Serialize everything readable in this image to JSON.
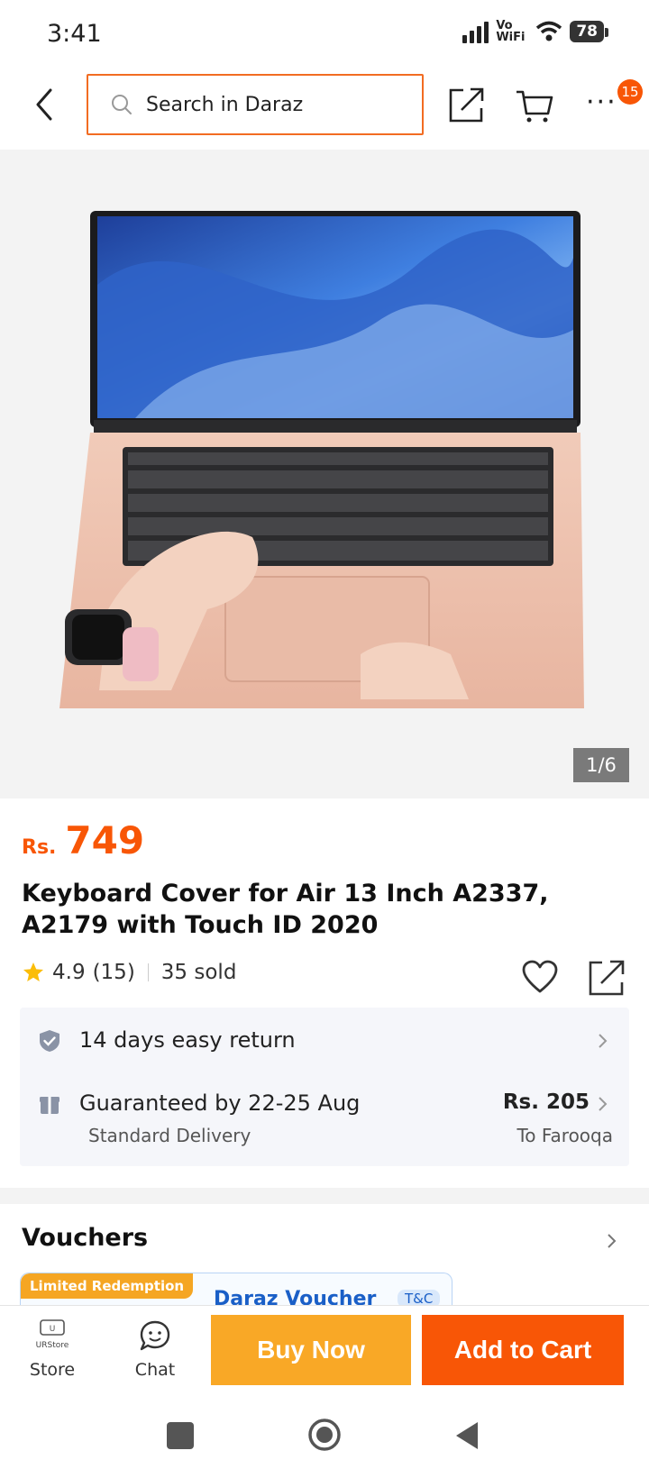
{
  "status_bar": {
    "time": "3:41",
    "network": "Vo WiFi",
    "battery": "78"
  },
  "header": {
    "search_placeholder": "Search in Daraz",
    "cart_badge": "15"
  },
  "product": {
    "image_counter": "1/6",
    "currency": "Rs.",
    "price": "749",
    "title": "Keyboard Cover for Air 13 Inch A2337, A2179 with Touch ID 2020",
    "rating": "4.9",
    "rating_count": "(15)",
    "sold": "35 sold"
  },
  "services": {
    "return_policy": "14 days easy return",
    "delivery_guarantee": "Guaranteed by 22-25 Aug",
    "delivery_type": "Standard Delivery",
    "delivery_price": "Rs. 205",
    "delivery_destination": "To Farooqa"
  },
  "vouchers": {
    "title": "Vouchers",
    "tag": "Limited Redemption",
    "voucher_name": "Daraz Voucher",
    "terms": "T&C"
  },
  "bottom_bar": {
    "store_label": "Store",
    "store_logo_text": "URStore",
    "chat_label": "Chat",
    "buy_now": "Buy Now",
    "add_to_cart": "Add to Cart"
  },
  "colors": {
    "brand_orange": "#f85606",
    "buy_now_yellow": "#f9a826",
    "search_border": "#f26c22",
    "voucher_blue": "#1a5fc7"
  }
}
